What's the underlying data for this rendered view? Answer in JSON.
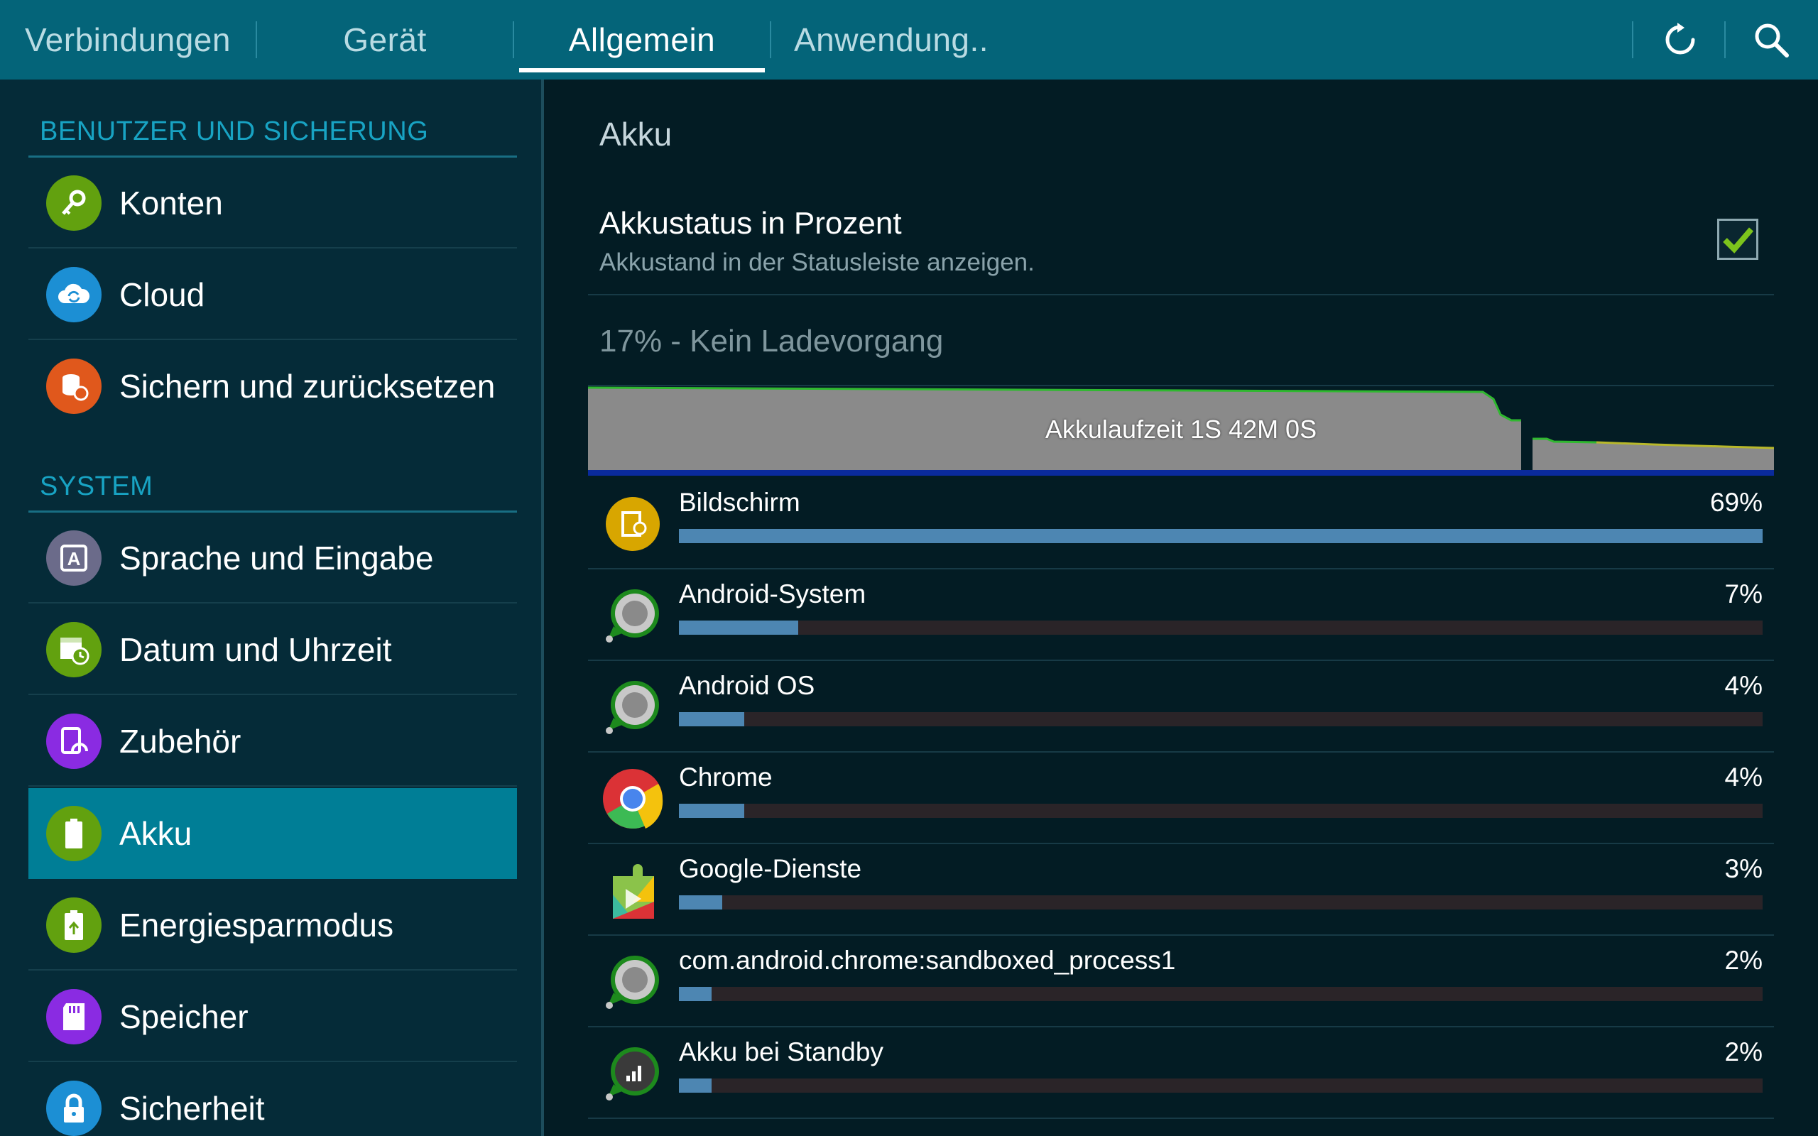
{
  "tabs": [
    {
      "label": "Verbindungen",
      "active": false
    },
    {
      "label": "Gerät",
      "active": false
    },
    {
      "label": "Allgemein",
      "active": true
    },
    {
      "label": "Anwendung..",
      "active": false
    }
  ],
  "toolbar": {
    "refresh_icon": "refresh-icon",
    "search_icon": "search-icon"
  },
  "sidebar": {
    "sections": [
      {
        "header": "BENUTZER UND SICHERUNG",
        "items": [
          {
            "label": "Konten",
            "icon": "key-icon",
            "color": "#62a10f"
          },
          {
            "label": "Cloud",
            "icon": "cloud-sync-icon",
            "color": "#1c8fd4"
          },
          {
            "label": "Sichern und zurücksetzen",
            "icon": "backup-restore-icon",
            "color": "#e0581c"
          }
        ]
      },
      {
        "header": "SYSTEM",
        "items": [
          {
            "label": "Sprache und Eingabe",
            "icon": "language-icon",
            "color": "#6b6b8a"
          },
          {
            "label": "Datum und Uhrzeit",
            "icon": "calendar-clock-icon",
            "color": "#62a10f"
          },
          {
            "label": "Zubehör",
            "icon": "accessory-icon",
            "color": "#8a2be2"
          },
          {
            "label": "Akku",
            "icon": "battery-icon",
            "color": "#62a10f",
            "selected": true
          },
          {
            "label": "Energiesparmodus",
            "icon": "power-saving-icon",
            "color": "#62a10f"
          },
          {
            "label": "Speicher",
            "icon": "sd-card-icon",
            "color": "#8a2be2"
          },
          {
            "label": "Sicherheit",
            "icon": "lock-icon",
            "color": "#1c8fd4"
          }
        ]
      }
    ]
  },
  "main": {
    "title": "Akku",
    "pref": {
      "title": "Akkustatus in Prozent",
      "subtitle": "Akkustand in der Statusleiste anzeigen.",
      "checked": true
    },
    "status": "17% - Kein Ladevorgang",
    "graph_label": "Akkulaufzeit 1S 42M 0S",
    "usage": [
      {
        "name": "Bildschirm",
        "percent": "69%",
        "fraction": 1.0,
        "icon": "screen-brightness-icon"
      },
      {
        "name": "Android-System",
        "percent": "7%",
        "fraction": 0.11,
        "icon": "android-system-icon"
      },
      {
        "name": "Android OS",
        "percent": "4%",
        "fraction": 0.06,
        "icon": "android-os-icon"
      },
      {
        "name": "Chrome",
        "percent": "4%",
        "fraction": 0.06,
        "icon": "chrome-icon"
      },
      {
        "name": "Google-Dienste",
        "percent": "3%",
        "fraction": 0.04,
        "icon": "google-services-icon"
      },
      {
        "name": "com.android.chrome:sandboxed_process1",
        "percent": "2%",
        "fraction": 0.03,
        "icon": "process-icon"
      },
      {
        "name": "Akku bei Standby",
        "percent": "2%",
        "fraction": 0.03,
        "icon": "standby-signal-icon"
      }
    ]
  }
}
